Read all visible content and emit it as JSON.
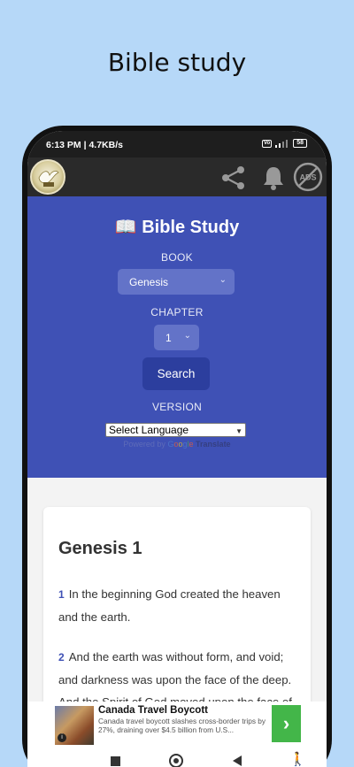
{
  "caption": "Bible study",
  "statusbar": {
    "time": "6:13 PM | 4.7KB/s",
    "vo_label": "Vo",
    "battery": "58"
  },
  "appbar": {
    "icons": [
      "share-icon",
      "bell-icon",
      "no-ads-icon"
    ],
    "ads_label": "ADS"
  },
  "hero": {
    "title": "📖 Bible Study",
    "book_label": "BOOK",
    "book_value": "Genesis",
    "chapter_label": "CHAPTER",
    "chapter_value": "1",
    "search_label": "Search",
    "version_label": "VERSION",
    "language_value": "Select Language",
    "powered_by": "Powered by",
    "google_letters": [
      "G",
      "o",
      "o",
      "g",
      "l",
      "e"
    ],
    "translate": "Translate"
  },
  "reading": {
    "heading": "Genesis 1",
    "verses": [
      {
        "num": "1",
        "text": "In the beginning God created the heaven and the earth."
      },
      {
        "num": "2",
        "text": "And the earth was without form, and void; and darkness was upon the face of the deep. And the Spirit of God moved upon the face of the waters."
      }
    ]
  },
  "ad": {
    "title": "Canada Travel Boycott",
    "description": "Canada travel boycott slashes cross-border trips by 27%, draining over $4.5 billion from U.S...",
    "info_icon": "i",
    "go_icon": "›"
  },
  "navbar": {
    "accessibility_glyph": "🚶"
  },
  "colors": {
    "background": "#b6d8f8",
    "hero": "#3f51b5",
    "button": "#2c3e9e",
    "ad_cta": "#43b649"
  }
}
